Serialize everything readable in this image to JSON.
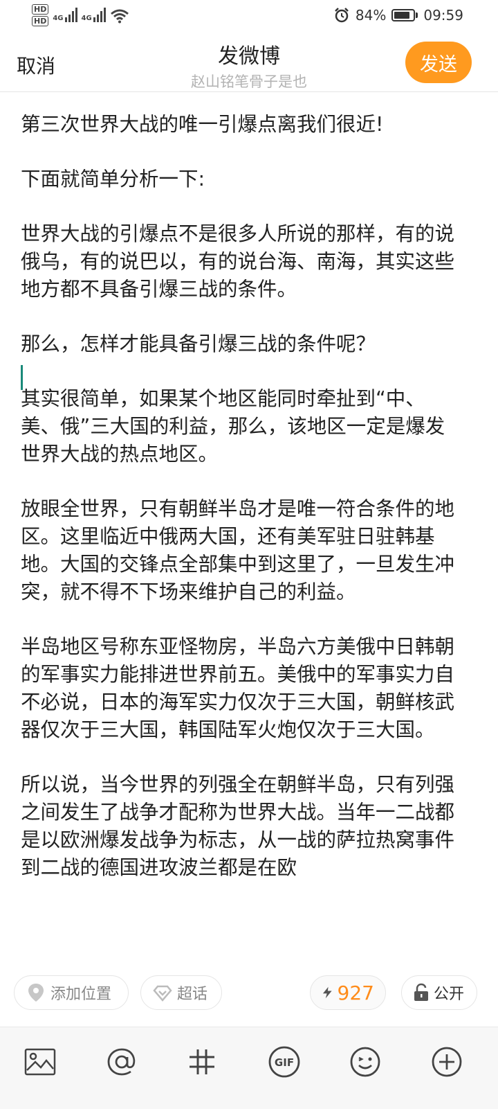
{
  "status_bar": {
    "hd1": "HD",
    "hd2": "HD",
    "net1": "4G",
    "net2": "4G",
    "battery": "84%",
    "battery_level": 0.84,
    "time": "09:59"
  },
  "header": {
    "cancel_label": "取消",
    "title": "发微博",
    "subtitle": "赵山铭笔骨子是也",
    "send_label": "发送"
  },
  "post": {
    "paragraphs": [
      "第三次世界大战的唯一引爆点离我们很近!",
      "下面就简单分析一下:",
      "世界大战的引爆点不是很多人所说的那样，有的说俄乌，有的说巴以，有的说台海、南海，其实这些地方都不具备引爆三战的条件。",
      "那么，怎样才能具备引爆三战的条件呢？",
      "其实很简单，如果某个地区能同时牵扯到“中、美、俄”三大国的利益，那么，该地区一定是爆发世界大战的热点地区。",
      "放眼全世界，只有朝鲜半岛才是唯一符合条件的地区。这里临近中俄两大国，还有美军驻日驻韩基地。大国的交锋点全部集中到这里了，一旦发生冲突，就不得不下场来维护自己的利益。",
      "半岛地区号称东亚怪物房，半岛六方美俄中日韩朝的军事实力能排进世界前五。美俄中的军事实力自不必说，日本的海军实力仅次于三大国，朝鲜核武器仅次于三大国，韩国陆军火炮仅次于三大国。",
      "所以说，当今世界的列强全在朝鲜半岛，只有列强之间发生了战争才配称为世界大战。当年一二战都是以欧洲爆发战争为标志，从一战的萨拉热窝事件到二战的德国进攻波兰都是在欧"
    ]
  },
  "chips": {
    "location_label": "添加位置",
    "topic_label": "超话",
    "count": "927",
    "visibility_label": "公开"
  },
  "colors": {
    "accent": "#ff9a1f",
    "cursor": "#1a8a7a",
    "count": "#ff8c1a"
  },
  "toolbar_icons": [
    "image-icon",
    "at-icon",
    "hashtag-icon",
    "gif-icon",
    "emoji-icon",
    "plus-icon"
  ]
}
